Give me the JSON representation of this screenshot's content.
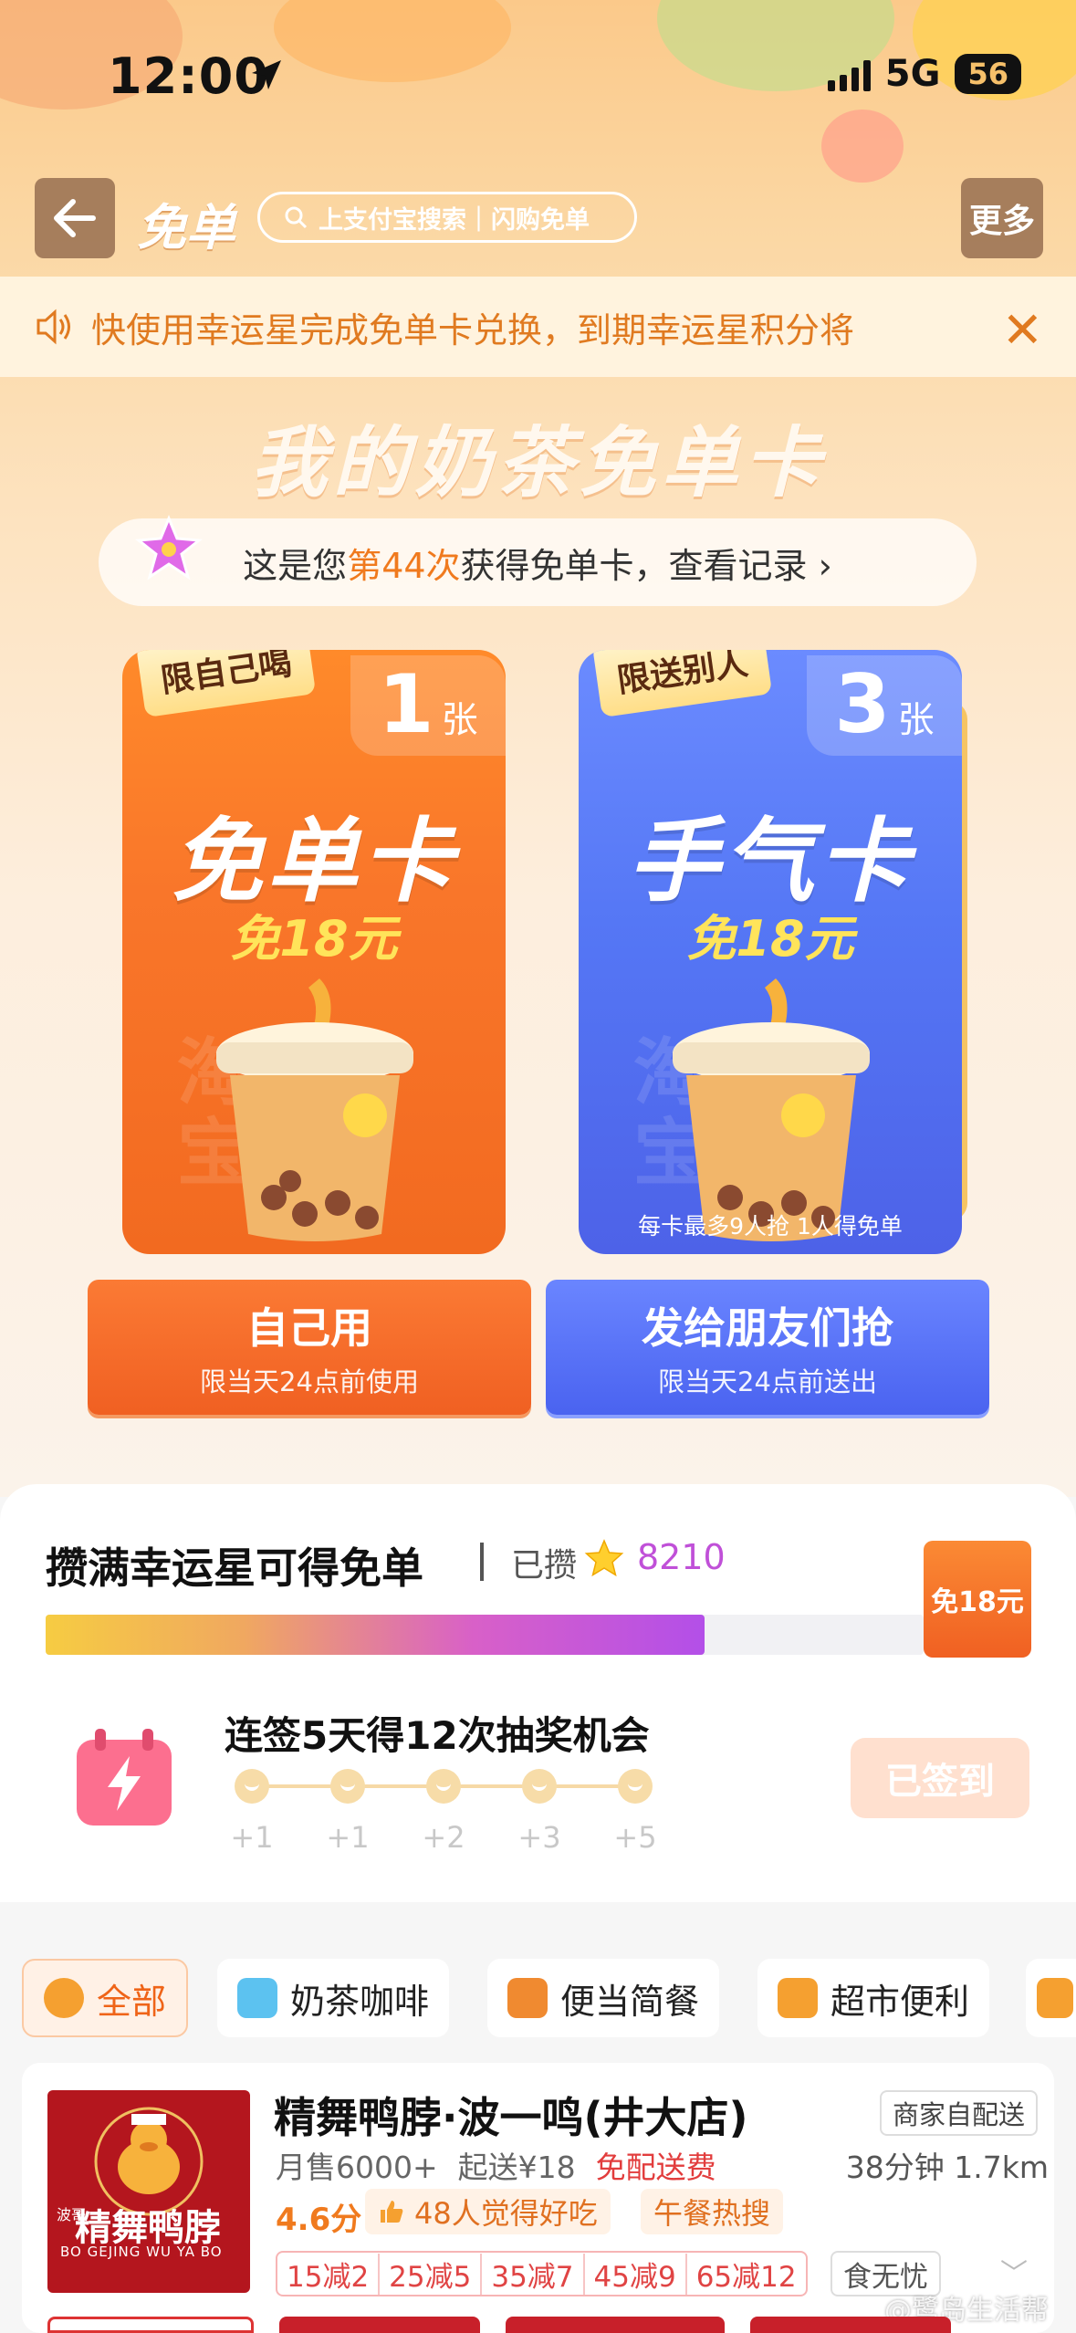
{
  "status_bar": {
    "time": "12:00",
    "network": "5G",
    "battery": "56"
  },
  "nav": {
    "title": "免单",
    "search_placeholder": "上支付宝搜索｜闪购免单",
    "more_label": "更多"
  },
  "notice": {
    "text": "快使用幸运星完成免单卡兑换，到期幸运星积分将"
  },
  "hero": {
    "title": "我的奶茶免单卡",
    "count_prefix": "这是您",
    "count_highlight": "第44次",
    "count_suffix": "获得免单卡，查看记录 ›"
  },
  "cards": [
    {
      "tag": "限自己喝",
      "count": "1",
      "unit": "张",
      "name": "免单卡",
      "sub": "免18元",
      "footer": ""
    },
    {
      "tag": "限送别人",
      "count": "3",
      "unit": "张",
      "name": "手气卡",
      "sub": "免18元",
      "footer": "每卡最多9人抢 1人得免单"
    }
  ],
  "actions": {
    "self": {
      "title": "自己用",
      "sub": "限当天24点前使用"
    },
    "friend": {
      "title": "发给朋友们抢",
      "sub": "限当天24点前送出"
    }
  },
  "lucky": {
    "title": "攒满幸运星可得免单",
    "got_label": "已攒",
    "value": "8210",
    "progress": 0.75,
    "badge": "免18元"
  },
  "signin": {
    "title": "连签5天得12次抽奖机会",
    "steps": [
      "+1",
      "+1",
      "+2",
      "+3",
      "+5"
    ],
    "button": "已签到"
  },
  "categories": [
    {
      "label": "全部",
      "active": true,
      "color": "#f5a030"
    },
    {
      "label": "奶茶咖啡",
      "active": false,
      "color": "#5cc2f0"
    },
    {
      "label": "便当简餐",
      "active": false,
      "color": "#f08a30"
    },
    {
      "label": "超市便利",
      "active": false,
      "color": "#f5a030"
    }
  ],
  "shop": {
    "name": "精舞鸭脖·波一鸣(井大店)",
    "delivery_tag": "商家自配送",
    "sales": "月售6000+",
    "min_order": "起送¥18",
    "free_delivery": "免配送费",
    "eta": "38分钟 1.7km",
    "score": "4.6分",
    "likes": "48人觉得好吃",
    "hot": "午餐热搜",
    "discounts": [
      "15减2",
      "25减5",
      "35减7",
      "45减9",
      "65减12"
    ],
    "safe": "食无忧",
    "logo_text": "精舞鸭脖",
    "logo_sub": "BO GEJING WU YA BO",
    "logo_side": "波哥"
  },
  "watermark": "@鹭岛生活帮"
}
